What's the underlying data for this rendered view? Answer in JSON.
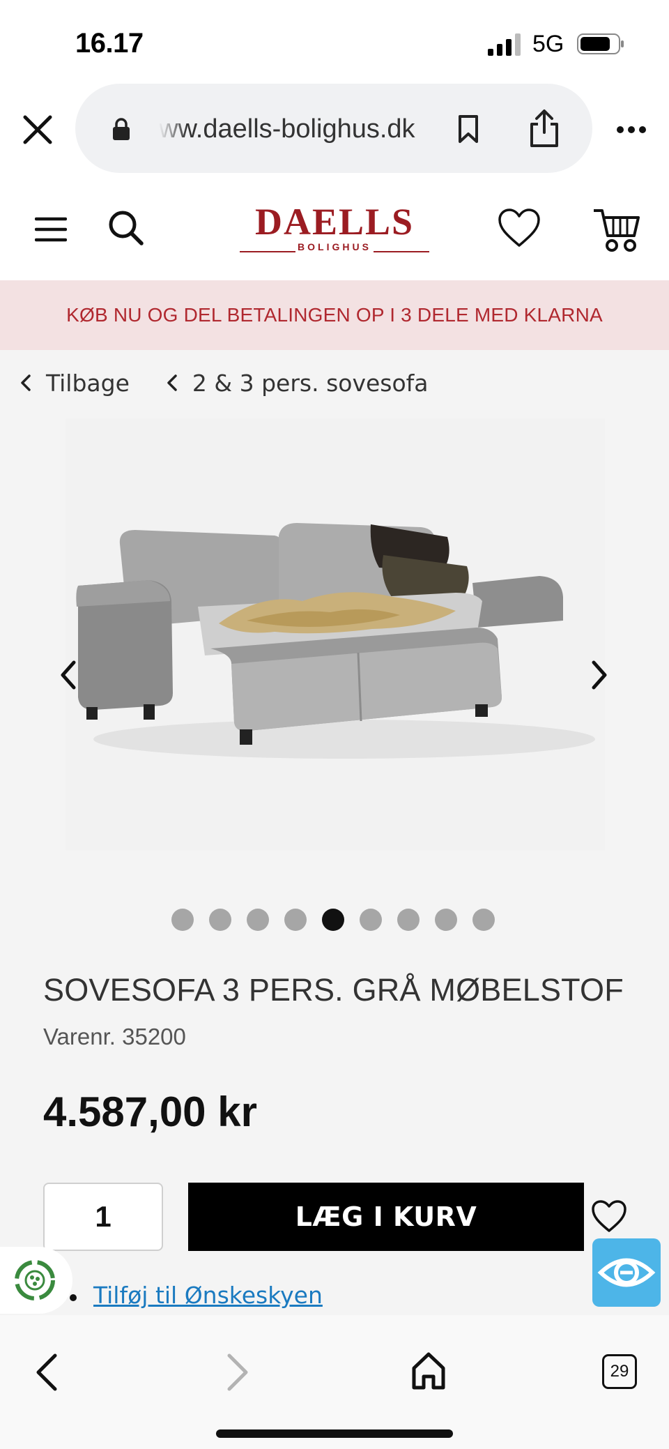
{
  "status_bar": {
    "time": "16.17",
    "network": "5G"
  },
  "browser": {
    "url": "ww.daells-bolighus.dk",
    "tab_count": "29"
  },
  "site": {
    "logo_main": "DAELLS",
    "logo_sub": "BOLIGHUS",
    "brand_color": "#9b1c22",
    "promo_text": "KØB NU OG DEL BETALINGEN OP I 3 DELE MED KLARNA"
  },
  "breadcrumb": {
    "back": "Tilbage",
    "category": "2 & 3 pers. sovesofa"
  },
  "gallery": {
    "image_count": 9,
    "active_index": 4
  },
  "product": {
    "title": "SOVESOFA 3 PERS. GRÅ MØBELSTOF",
    "sku": "Varenr. 35200",
    "price": "4.587,00 kr",
    "quantity": "1",
    "add_to_cart": "LÆG I KURV",
    "wishlist_link": "Tilføj til Ønskeskyen"
  }
}
